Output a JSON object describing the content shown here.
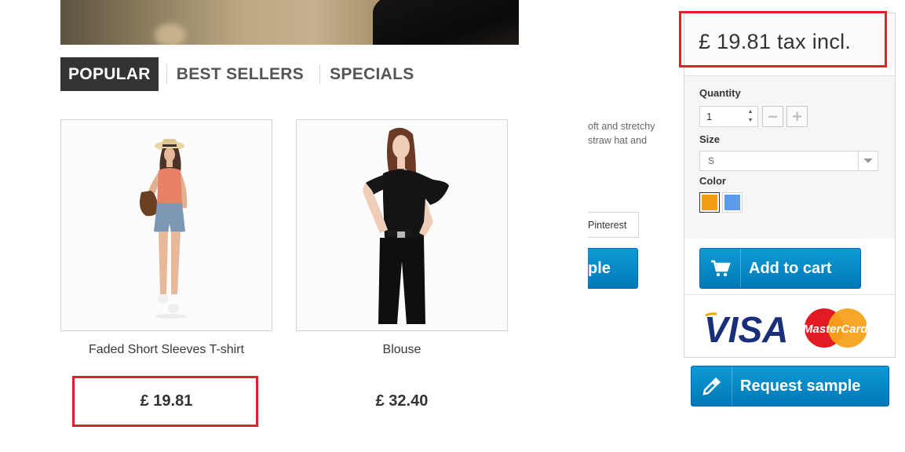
{
  "tabs": [
    {
      "label": "POPULAR",
      "active": true
    },
    {
      "label": "BEST SELLERS",
      "active": false
    },
    {
      "label": "SPECIALS",
      "active": false
    }
  ],
  "products": [
    {
      "name": "Faded Short Sleeves T-shirt",
      "price": "£ 19.81",
      "highlighted": true
    },
    {
      "name": "Blouse",
      "price": "£ 32.40",
      "highlighted": false
    }
  ],
  "description": {
    "line1": "oft and stretchy",
    "line2": " straw hat and"
  },
  "share": {
    "pinterest": "Pinterest"
  },
  "clipped_button": {
    "label": "ple"
  },
  "buybox": {
    "price": "£ 19.81 tax incl.",
    "quantity_label": "Quantity",
    "quantity_value": "1",
    "minus": "−",
    "plus": "+",
    "size_label": "Size",
    "size_value": "S",
    "color_label": "Color",
    "colors": [
      "#f39d13",
      "#5d9cec"
    ],
    "add_to_cart": "Add to cart",
    "payment_visa": "VISA",
    "payment_mastercard": "MasterCard"
  },
  "request_sample": "Request sample",
  "colors": {
    "accent_blue": "#0b8bc6",
    "highlight_red": "#e0202b",
    "tab_active_bg": "#333333"
  }
}
